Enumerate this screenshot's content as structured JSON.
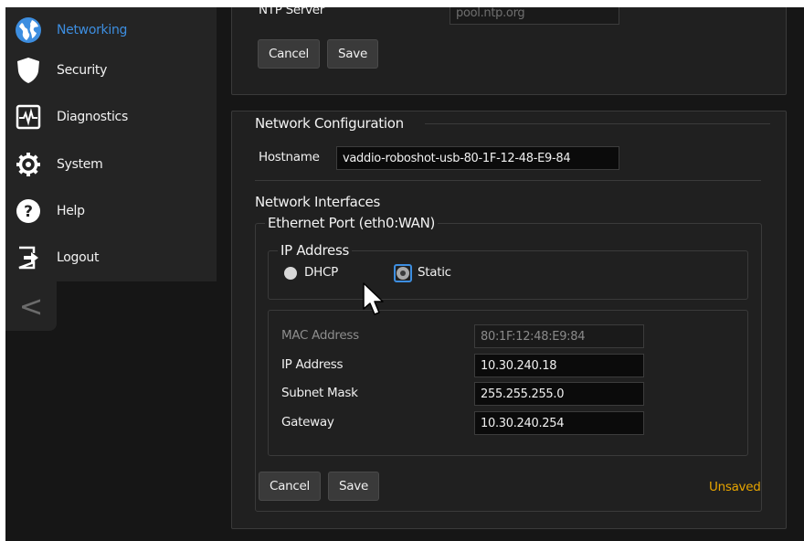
{
  "sidebar": {
    "items": [
      {
        "label": "Networking",
        "icon": "globe-icon",
        "active": true
      },
      {
        "label": "Security",
        "icon": "shield-icon",
        "active": false
      },
      {
        "label": "Diagnostics",
        "icon": "diagnostics-pulse-icon",
        "active": false
      },
      {
        "label": "System",
        "icon": "gear-icon",
        "active": false
      },
      {
        "label": "Help",
        "icon": "help-icon",
        "active": false
      },
      {
        "label": "Logout",
        "icon": "logout-icon",
        "active": false
      }
    ],
    "collapse_label": "<"
  },
  "ntp": {
    "label": "NTP Server",
    "value": "pool.ntp.org",
    "cancel_label": "Cancel",
    "save_label": "Save"
  },
  "network": {
    "title": "Network Configuration",
    "hostname_label": "Hostname",
    "hostname_value": "vaddio-roboshot-usb-80-1F-12-48-E9-84",
    "interfaces_title": "Network Interfaces",
    "ethernet_legend": "Ethernet Port (eth0:WAN)",
    "ip_legend": "IP Address",
    "dhcp_label": "DHCP",
    "static_label": "Static",
    "selected_mode": "Static",
    "mac_label": "MAC Address",
    "mac_value": "80:1F:12:48:E9:84",
    "ip_label": "IP Address",
    "ip_value": "10.30.240.18",
    "subnet_label": "Subnet Mask",
    "subnet_value": "255.255.255.0",
    "gateway_label": "Gateway",
    "gateway_value": "10.30.240.254",
    "cancel_label": "Cancel",
    "save_label": "Save",
    "status": "Unsaved"
  },
  "colors": {
    "accent": "#3d8ee0",
    "unsaved": "#e6a400",
    "background": "#161616",
    "panel": "#202020"
  }
}
